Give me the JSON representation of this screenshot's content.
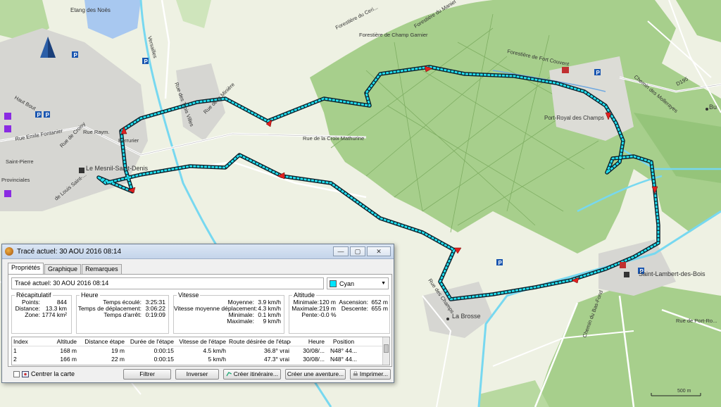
{
  "map": {
    "labels": {
      "etang": "Etang des Noës",
      "forestiere_ceri": "Forestière du Ceri...",
      "forestiere_maniel": "Forestière du Maniel",
      "forestiere_champ_garnier": "Forestière de Champ Garnier",
      "forestiere_fort_couvent": "Forestière de Fort Couvent",
      "chemin_moines": "Chemin des Mollerayes",
      "d195": "D195",
      "bu": "Bu",
      "port_royal": "Port-Royal des Champs",
      "rue_miniere": "Rue de la Minière",
      "rue_trois_villes": "Rue des Trois Villes",
      "rue_croix_mathurine": "Rue de la Croix Mathurine",
      "mesnil": "Le Mesnil-Saint-Denis",
      "rue_emile": "Rue Emile Fontanier",
      "rue_croisy": "Rue de Croisy",
      "rue_raym": "Rue Raym.",
      "berrurier": "Berrurier",
      "saint_pierre": "Saint-Pierre",
      "provinciales": "Provinciales",
      "rue_de_louis": "de Louis Saint-...",
      "haut_bout": "Haut Bout",
      "versailles": "Versailles",
      "saint_lambert": "Saint-Lambert-des-Bois",
      "la_brosse": "La Brosse",
      "rue_champs": "Rue des Champs",
      "chemin_bas": "Chemin du Bas-Fond",
      "rue_port_royal": "Rue de Port-Ro...",
      "scale": "500 m"
    }
  },
  "dialog": {
    "title": "Tracé actuel: 30 AOU 2016 08:14",
    "window_buttons": {
      "minimize": "—",
      "maximize": "▢",
      "close": "✕"
    },
    "tabs": [
      "Propriétés",
      "Graphique",
      "Remarques"
    ],
    "track_name": "Tracé actuel: 30 AOU 2016 08:14",
    "color": {
      "label": "Cyan",
      "hex": "#00e5ff"
    },
    "recap": {
      "legend": "Récapitulatif",
      "points_label": "Points:",
      "points": "844",
      "distance_label": "Distance:",
      "distance": "13.3 km",
      "zone_label": "Zone:",
      "zone": "1774 km²"
    },
    "heure": {
      "legend": "Heure",
      "elapsed_label": "Temps écoulé:",
      "elapsed": "3:25:31",
      "moving_label": "Temps de déplacement:",
      "moving": "3:06:22",
      "stopped_label": "Temps d'arrêt:",
      "stopped": "0:19:09"
    },
    "vitesse": {
      "legend": "Vitesse",
      "avg_label": "Moyenne:",
      "avg": "3.9 km/h",
      "moving_avg_label": "Vitesse moyenne déplacement:",
      "moving_avg": "4.3 km/h",
      "min_label": "Minimale:",
      "min": "0.1 km/h",
      "max_label": "Maximale:",
      "max": "9 km/h"
    },
    "altitude": {
      "legend": "Altitude",
      "min_label": "Minimale:",
      "min": "120 m",
      "max_label": "Maximale:",
      "max": "219 m",
      "slope_label": "Pente:",
      "slope": "-0.0 %",
      "ascent_label": "Ascension:",
      "ascent": "652 m",
      "descent_label": "Descente:",
      "descent": "655 m"
    },
    "grid": {
      "headers": [
        "Index",
        "Altitude",
        "Distance étape",
        "Durée de l'étape",
        "Vitesse de l'étape",
        "Route désirée de l'étape",
        "Heure",
        "Position"
      ],
      "rows": [
        [
          "1",
          "168 m",
          "19 m",
          "0:00:15",
          "4.5 km/h",
          "36.8° vrai",
          "30/08/...",
          "N48° 44..."
        ],
        [
          "2",
          "166 m",
          "22 m",
          "0:00:15",
          "5 km/h",
          "47.3° vrai",
          "30/08/...",
          "N48° 44..."
        ]
      ]
    },
    "bottom": {
      "center_map": "Centrer la carte",
      "filter": "Filtrer",
      "invert": "Inverser",
      "create_route": "Créer itinéraire...",
      "create_adventure": "Créer une aventure...",
      "print": "Imprimer..."
    }
  }
}
